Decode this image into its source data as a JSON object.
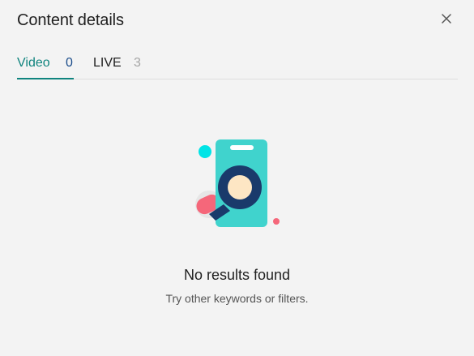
{
  "dialog": {
    "title": "Content details",
    "close_icon": "close-icon"
  },
  "tabs": [
    {
      "label": "Video",
      "count": "0",
      "active": true
    },
    {
      "label": "LIVE",
      "count": "3",
      "active": false
    }
  ],
  "empty_state": {
    "illustration_icon": "search-phone-illustration-icon",
    "title": "No results found",
    "subtitle": "Try other keywords or filters."
  },
  "colors": {
    "active_tab": "#10847e",
    "active_count": "#1a4c8a",
    "inactive_count": "#a6a6a6",
    "background": "#f3f3f3",
    "phone": "#40d3cd",
    "magnifier": "#1a3a6b",
    "lens": "#fde6c4",
    "accent_pink": "#f5677a",
    "accent_cyan": "#00e4e6"
  }
}
